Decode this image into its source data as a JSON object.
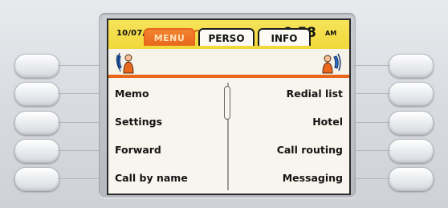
{
  "status_bar": {
    "date": "10/07/03",
    "time": "9:58",
    "ampm": "AM",
    "icons": [
      "headset-icon",
      "bell-icon",
      "clock-icon",
      "lock-icon"
    ]
  },
  "tabs": [
    {
      "label": "MENU",
      "active": true
    },
    {
      "label": "PERSO",
      "active": false
    },
    {
      "label": "INFO",
      "active": false
    }
  ],
  "menu": {
    "left": [
      "Memo",
      "Settings",
      "Forward",
      "Call by name"
    ],
    "right": [
      "Redial list",
      "Hotel",
      "Call routing",
      "Messaging"
    ]
  },
  "colors": {
    "status_bar": "#f1d83a",
    "active_tab": "#e8671c",
    "screen_bg": "#f5f3ea",
    "device_bg": "#d9dbe0"
  }
}
